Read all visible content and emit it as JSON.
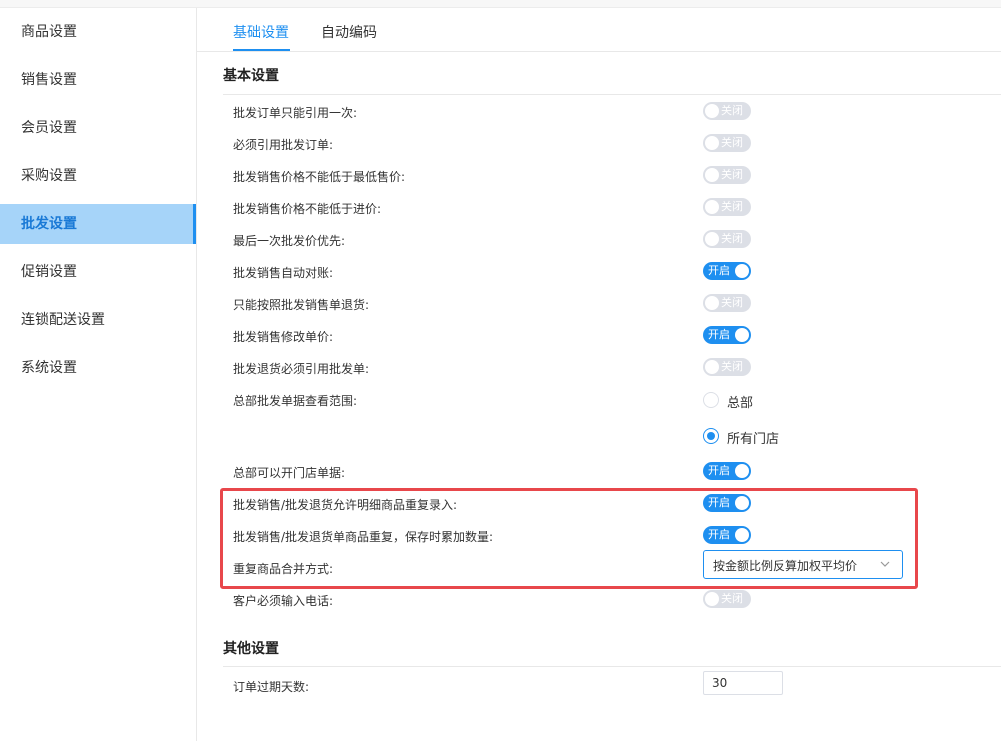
{
  "sidebar": {
    "items": [
      {
        "label": "商品设置"
      },
      {
        "label": "销售设置"
      },
      {
        "label": "会员设置"
      },
      {
        "label": "采购设置"
      },
      {
        "label": "批发设置",
        "active": true
      },
      {
        "label": "促销设置"
      },
      {
        "label": "连锁配送设置"
      },
      {
        "label": "系统设置"
      }
    ]
  },
  "tabs": [
    {
      "label": "基础设置",
      "active": true
    },
    {
      "label": "自动编码"
    }
  ],
  "sections": {
    "basic": "基本设置",
    "other": "其他设置"
  },
  "switch_text": {
    "on": "开启",
    "off": "关闭"
  },
  "settings": [
    {
      "label": "批发订单只能引用一次:",
      "state": "off"
    },
    {
      "label": "必须引用批发订单:",
      "state": "off"
    },
    {
      "label": "批发销售价格不能低于最低售价:",
      "state": "off"
    },
    {
      "label": "批发销售价格不能低于进价:",
      "state": "off"
    },
    {
      "label": "最后一次批发价优先:",
      "state": "off"
    },
    {
      "label": "批发销售自动对账:",
      "state": "on"
    },
    {
      "label": "只能按照批发销售单退货:",
      "state": "off"
    },
    {
      "label": "批发销售修改单价:",
      "state": "on"
    },
    {
      "label": "批发退货必须引用批发单:",
      "state": "off"
    }
  ],
  "scope": {
    "label": "总部批发单据查看范围:",
    "options": [
      {
        "label": "总部",
        "checked": false
      },
      {
        "label": "所有门店",
        "checked": true
      }
    ]
  },
  "open_store_docs": {
    "label": "总部可以开门店单据:",
    "state": "on"
  },
  "highlighted": {
    "allow_duplicate": {
      "label": "批发销售/批发退货允许明细商品重复录入:",
      "state": "on"
    },
    "accumulate_qty": {
      "label": "批发销售/批发退货单商品重复，保存时累加数量:",
      "state": "on"
    },
    "merge_method": {
      "label": "重复商品合并方式:",
      "value": "按金额比例反算加权平均价"
    }
  },
  "customer_phone": {
    "label": "客户必须输入电话:",
    "state": "off"
  },
  "expire_days": {
    "label": "订单过期天数:",
    "value": "30"
  },
  "colors": {
    "accent": "#1e8ff0",
    "highlight_border": "#e8474b",
    "active_bg": "#a6d4f9"
  }
}
